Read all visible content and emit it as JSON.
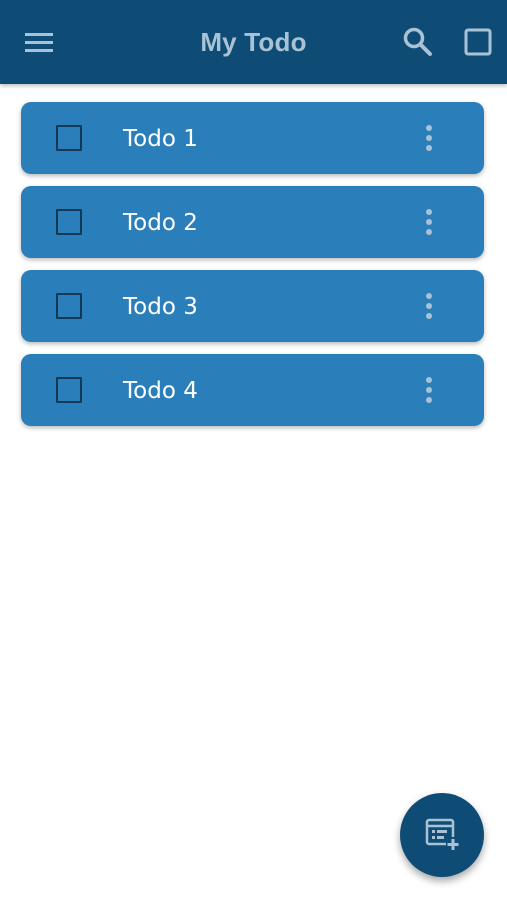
{
  "appbar": {
    "title": "My Todo",
    "menu_icon": "menu-icon",
    "search_icon": "search-icon",
    "select_icon": "checkbox-outline-icon"
  },
  "todos": [
    {
      "label": "Todo 1",
      "checked": false
    },
    {
      "label": "Todo 2",
      "checked": false
    },
    {
      "label": "Todo 3",
      "checked": false
    },
    {
      "label": "Todo 4",
      "checked": false
    }
  ],
  "fab": {
    "icon": "add-list-icon"
  },
  "colors": {
    "appbar": "#0f4c75",
    "item": "#2a7fba",
    "title": "#a9c2d6",
    "fab": "#0f4c75"
  }
}
